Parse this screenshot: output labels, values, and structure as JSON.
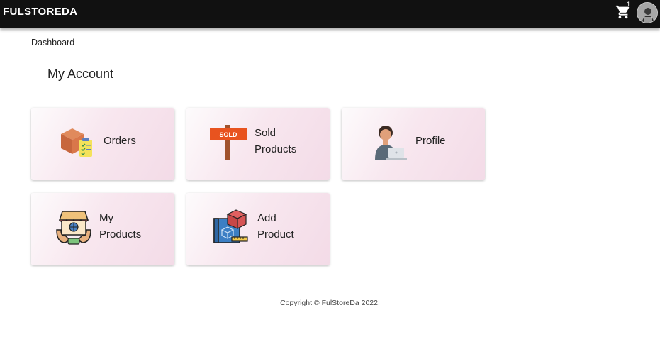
{
  "header": {
    "brand": "FULSTOREDA",
    "cart_icon": "shopping-cart-icon",
    "cart_count": "1",
    "avatar_icon": "user-avatar"
  },
  "breadcrumb": "Dashboard",
  "page_title": "My Account",
  "cards": [
    {
      "label": "Orders",
      "icon": "box-checklist-icon"
    },
    {
      "label": "Sold\nProducts",
      "icon": "sold-sign-icon"
    },
    {
      "label": "Profile",
      "icon": "person-laptop-icon"
    },
    {
      "label": "My\nProducts",
      "icon": "storefront-icon"
    },
    {
      "label": "Add\nProduct",
      "icon": "package-blueprint-icon"
    }
  ],
  "footer": {
    "prefix": "Copyright ©",
    "link": "FulStoreDa",
    "suffix": "2022."
  },
  "colors": {
    "appbar": "#111111",
    "card_gradient_end": "#f3dbe7"
  }
}
